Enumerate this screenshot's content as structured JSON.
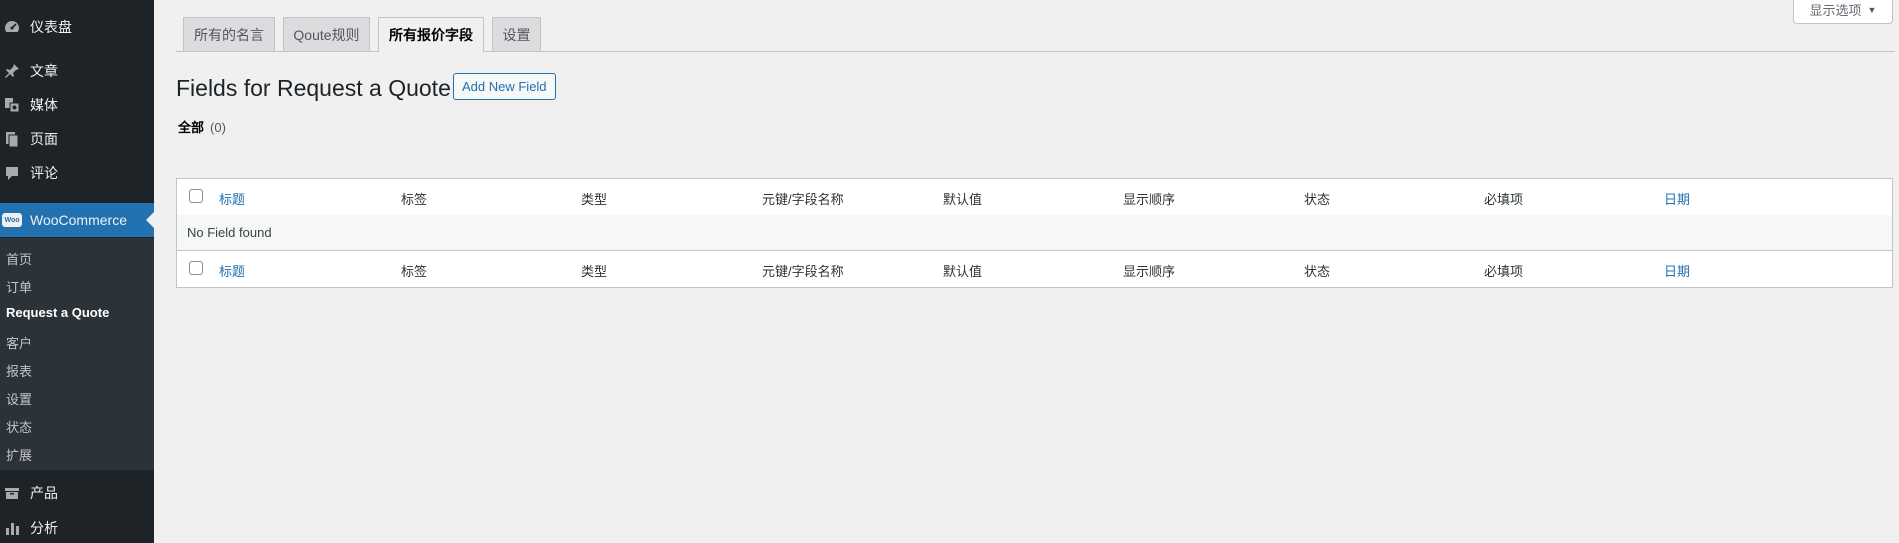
{
  "sidebar": {
    "items": [
      {
        "label": "仪表盘",
        "icon": "dashboard-icon"
      },
      {
        "label": "文章",
        "icon": "pin-icon"
      },
      {
        "label": "媒体",
        "icon": "media-icon"
      },
      {
        "label": "页面",
        "icon": "page-icon"
      },
      {
        "label": "评论",
        "icon": "comment-icon"
      }
    ],
    "woocommerce": {
      "label": "WooCommerce",
      "badge": "Woo"
    },
    "submenu": [
      "首页",
      "订单",
      "Request a Quote",
      "客户",
      "报表",
      "设置",
      "状态",
      "扩展"
    ],
    "current_submenu": "Request a Quote",
    "bottom_items": [
      {
        "label": "产品",
        "icon": "products-icon"
      },
      {
        "label": "分析",
        "icon": "analytics-icon"
      }
    ]
  },
  "screen_options": {
    "label": "显示选项",
    "arrow": "▼"
  },
  "tabs": [
    {
      "label": "所有的名言",
      "active": false
    },
    {
      "label": "Qoute规则",
      "active": false
    },
    {
      "label": "所有报价字段",
      "active": true
    },
    {
      "label": "设置",
      "active": false
    }
  ],
  "page": {
    "title": "Fields for Request a Quote",
    "add_new_label": "Add New Field",
    "filter_all": "全部",
    "filter_count": "(0)"
  },
  "table": {
    "columns": [
      "标题",
      "标签",
      "类型",
      "元键/字段名称",
      "默认值",
      "显示顺序",
      "状态",
      "必填项",
      "日期"
    ],
    "sortable": [
      true,
      false,
      false,
      false,
      false,
      false,
      false,
      false,
      true
    ],
    "empty_message": "No Field found"
  },
  "colors": {
    "sidebar_bg": "#1d2327",
    "accent": "#2271b1",
    "page_bg": "#f0f0f1"
  }
}
